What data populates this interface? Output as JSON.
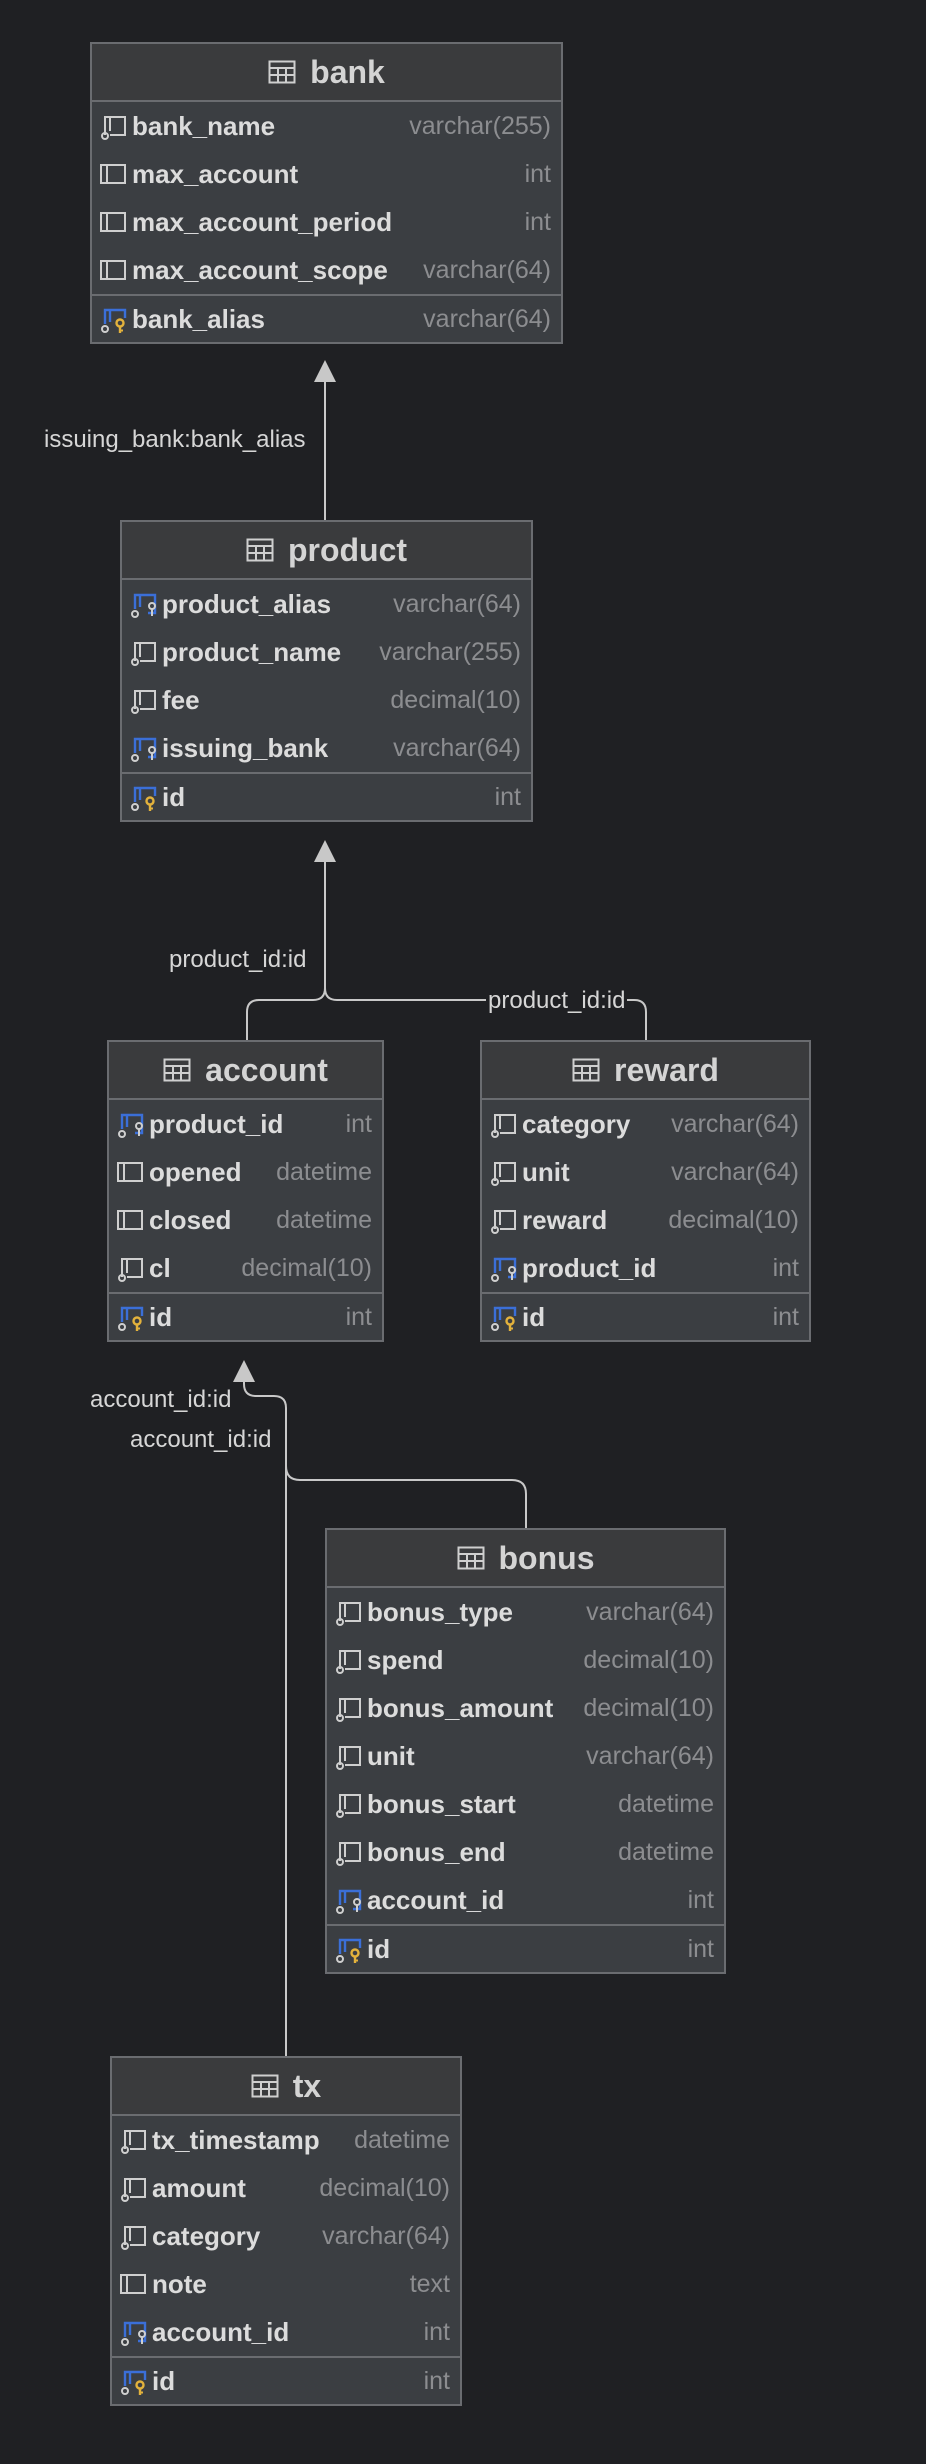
{
  "colors": {
    "background": "#1f2023",
    "table_fill": "#3b3e42",
    "table_border": "#6a6c70",
    "fk_icon": "#3b6fd8",
    "pk_key": "#e3b23c",
    "connector": "#c8c8c8"
  },
  "icons": {
    "table": "table-grid-icon",
    "column": "column-icon",
    "nullable_column": "nullable-column-icon",
    "foreign_key": "foreign-key-icon",
    "primary_key": "primary-key-icon"
  },
  "tables": [
    {
      "id": "bank",
      "name": "bank",
      "columns": [
        {
          "name": "bank_name",
          "type": "varchar(255)",
          "icon": "nullable_column"
        },
        {
          "name": "max_account",
          "type": "int",
          "icon": "column"
        },
        {
          "name": "max_account_period",
          "type": "int",
          "icon": "column"
        },
        {
          "name": "max_account_scope",
          "type": "varchar(64)",
          "icon": "column"
        }
      ],
      "keys": [
        {
          "name": "bank_alias",
          "type": "varchar(64)",
          "icon": "primary_key"
        }
      ]
    },
    {
      "id": "product",
      "name": "product",
      "columns": [
        {
          "name": "product_alias",
          "type": "varchar(64)",
          "icon": "foreign_key"
        },
        {
          "name": "product_name",
          "type": "varchar(255)",
          "icon": "nullable_column"
        },
        {
          "name": "fee",
          "type": "decimal(10)",
          "icon": "nullable_column"
        },
        {
          "name": "issuing_bank",
          "type": "varchar(64)",
          "icon": "foreign_key"
        }
      ],
      "keys": [
        {
          "name": "id",
          "type": "int",
          "icon": "primary_key"
        }
      ]
    },
    {
      "id": "account",
      "name": "account",
      "columns": [
        {
          "name": "product_id",
          "type": "int",
          "icon": "foreign_key"
        },
        {
          "name": "opened",
          "type": "datetime",
          "icon": "column"
        },
        {
          "name": "closed",
          "type": "datetime",
          "icon": "column"
        },
        {
          "name": "cl",
          "type": "decimal(10)",
          "icon": "nullable_column"
        }
      ],
      "keys": [
        {
          "name": "id",
          "type": "int",
          "icon": "primary_key"
        }
      ]
    },
    {
      "id": "reward",
      "name": "reward",
      "columns": [
        {
          "name": "category",
          "type": "varchar(64)",
          "icon": "nullable_column"
        },
        {
          "name": "unit",
          "type": "varchar(64)",
          "icon": "nullable_column"
        },
        {
          "name": "reward",
          "type": "decimal(10)",
          "icon": "nullable_column"
        },
        {
          "name": "product_id",
          "type": "int",
          "icon": "foreign_key"
        }
      ],
      "keys": [
        {
          "name": "id",
          "type": "int",
          "icon": "primary_key"
        }
      ]
    },
    {
      "id": "bonus",
      "name": "bonus",
      "columns": [
        {
          "name": "bonus_type",
          "type": "varchar(64)",
          "icon": "nullable_column"
        },
        {
          "name": "spend",
          "type": "decimal(10)",
          "icon": "nullable_column"
        },
        {
          "name": "bonus_amount",
          "type": "decimal(10)",
          "icon": "nullable_column"
        },
        {
          "name": "unit",
          "type": "varchar(64)",
          "icon": "nullable_column"
        },
        {
          "name": "bonus_start",
          "type": "datetime",
          "icon": "nullable_column"
        },
        {
          "name": "bonus_end",
          "type": "datetime",
          "icon": "nullable_column"
        },
        {
          "name": "account_id",
          "type": "int",
          "icon": "foreign_key"
        }
      ],
      "keys": [
        {
          "name": "id",
          "type": "int",
          "icon": "primary_key"
        }
      ]
    },
    {
      "id": "tx",
      "name": "tx",
      "columns": [
        {
          "name": "tx_timestamp",
          "type": "datetime",
          "icon": "nullable_column"
        },
        {
          "name": "amount",
          "type": "decimal(10)",
          "icon": "nullable_column"
        },
        {
          "name": "category",
          "type": "varchar(64)",
          "icon": "nullable_column"
        },
        {
          "name": "note",
          "type": "text",
          "icon": "column"
        },
        {
          "name": "account_id",
          "type": "int",
          "icon": "foreign_key"
        }
      ],
      "keys": [
        {
          "name": "id",
          "type": "int",
          "icon": "primary_key"
        }
      ]
    }
  ],
  "relations": [
    {
      "id": "product-bank",
      "label": "issuing_bank:bank_alias"
    },
    {
      "id": "account-product",
      "label": "product_id:id"
    },
    {
      "id": "reward-product",
      "label": "product_id:id"
    },
    {
      "id": "tx-account",
      "label": "account_id:id"
    },
    {
      "id": "bonus-account",
      "label": "account_id:id"
    }
  ]
}
